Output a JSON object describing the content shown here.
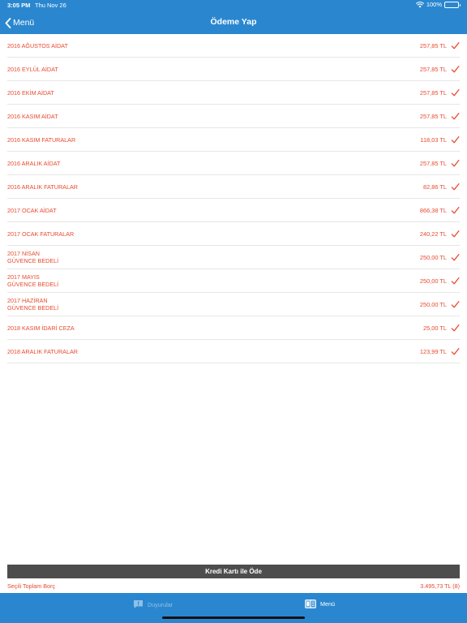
{
  "status_bar": {
    "time": "3:05 PM",
    "date": "Thu Nov 26",
    "battery": "100%",
    "battery_level": 1.0
  },
  "nav": {
    "back_label": "Menü",
    "title": "Ödeme Yap"
  },
  "items": [
    {
      "name": "2016 AĞUSTOS AİDAT",
      "amount": "257,85 TL"
    },
    {
      "name": "2016 EYLÜL AİDAT",
      "amount": "257,85 TL"
    },
    {
      "name": "2016 EKİM AİDAT",
      "amount": "257,85 TL"
    },
    {
      "name": "2016 KASIM AİDAT",
      "amount": "257,85 TL"
    },
    {
      "name": "2016 KASIM FATURALAR",
      "amount": "118,03 TL"
    },
    {
      "name": "2016 ARALIK AİDAT",
      "amount": "257,85 TL"
    },
    {
      "name": "2016 ARALIK FATURALAR",
      "amount": "82,86 TL"
    },
    {
      "name": "2017 OCAK AİDAT",
      "amount": "866,38 TL"
    },
    {
      "name": "2017 OCAK FATURALAR",
      "amount": "240,22 TL"
    },
    {
      "name": "2017 NİSAN",
      "name2": "GÜVENCE BEDELİ",
      "amount": "250,00 TL"
    },
    {
      "name": "2017 MAYIS",
      "name2": "GÜVENCE BEDELİ",
      "amount": "250,00 TL"
    },
    {
      "name": "2017 HAZİRAN",
      "name2": "GÜVENCE BEDELİ",
      "amount": "250,00 TL"
    },
    {
      "name": "2018 KASIM İDARİ CEZA",
      "amount": "25,00 TL"
    },
    {
      "name": "2018 ARALIK FATURALAR",
      "amount": "123,99 TL"
    }
  ],
  "pay_button_label": "Kredi Kartı ile Öde",
  "total": {
    "label": "Seçili Toplam Borç",
    "value": "3.495,73 TL (8)"
  },
  "tabs": [
    {
      "label": "Duyurular",
      "icon": "announcement-icon",
      "active": false
    },
    {
      "label": "Menü",
      "icon": "menu-book-icon",
      "active": true
    }
  ],
  "colors": {
    "accent": "#2a87cf",
    "item_text": "#e84a2f",
    "button": "#4d4d4d",
    "tab_inactive": "#8fc1e8"
  }
}
